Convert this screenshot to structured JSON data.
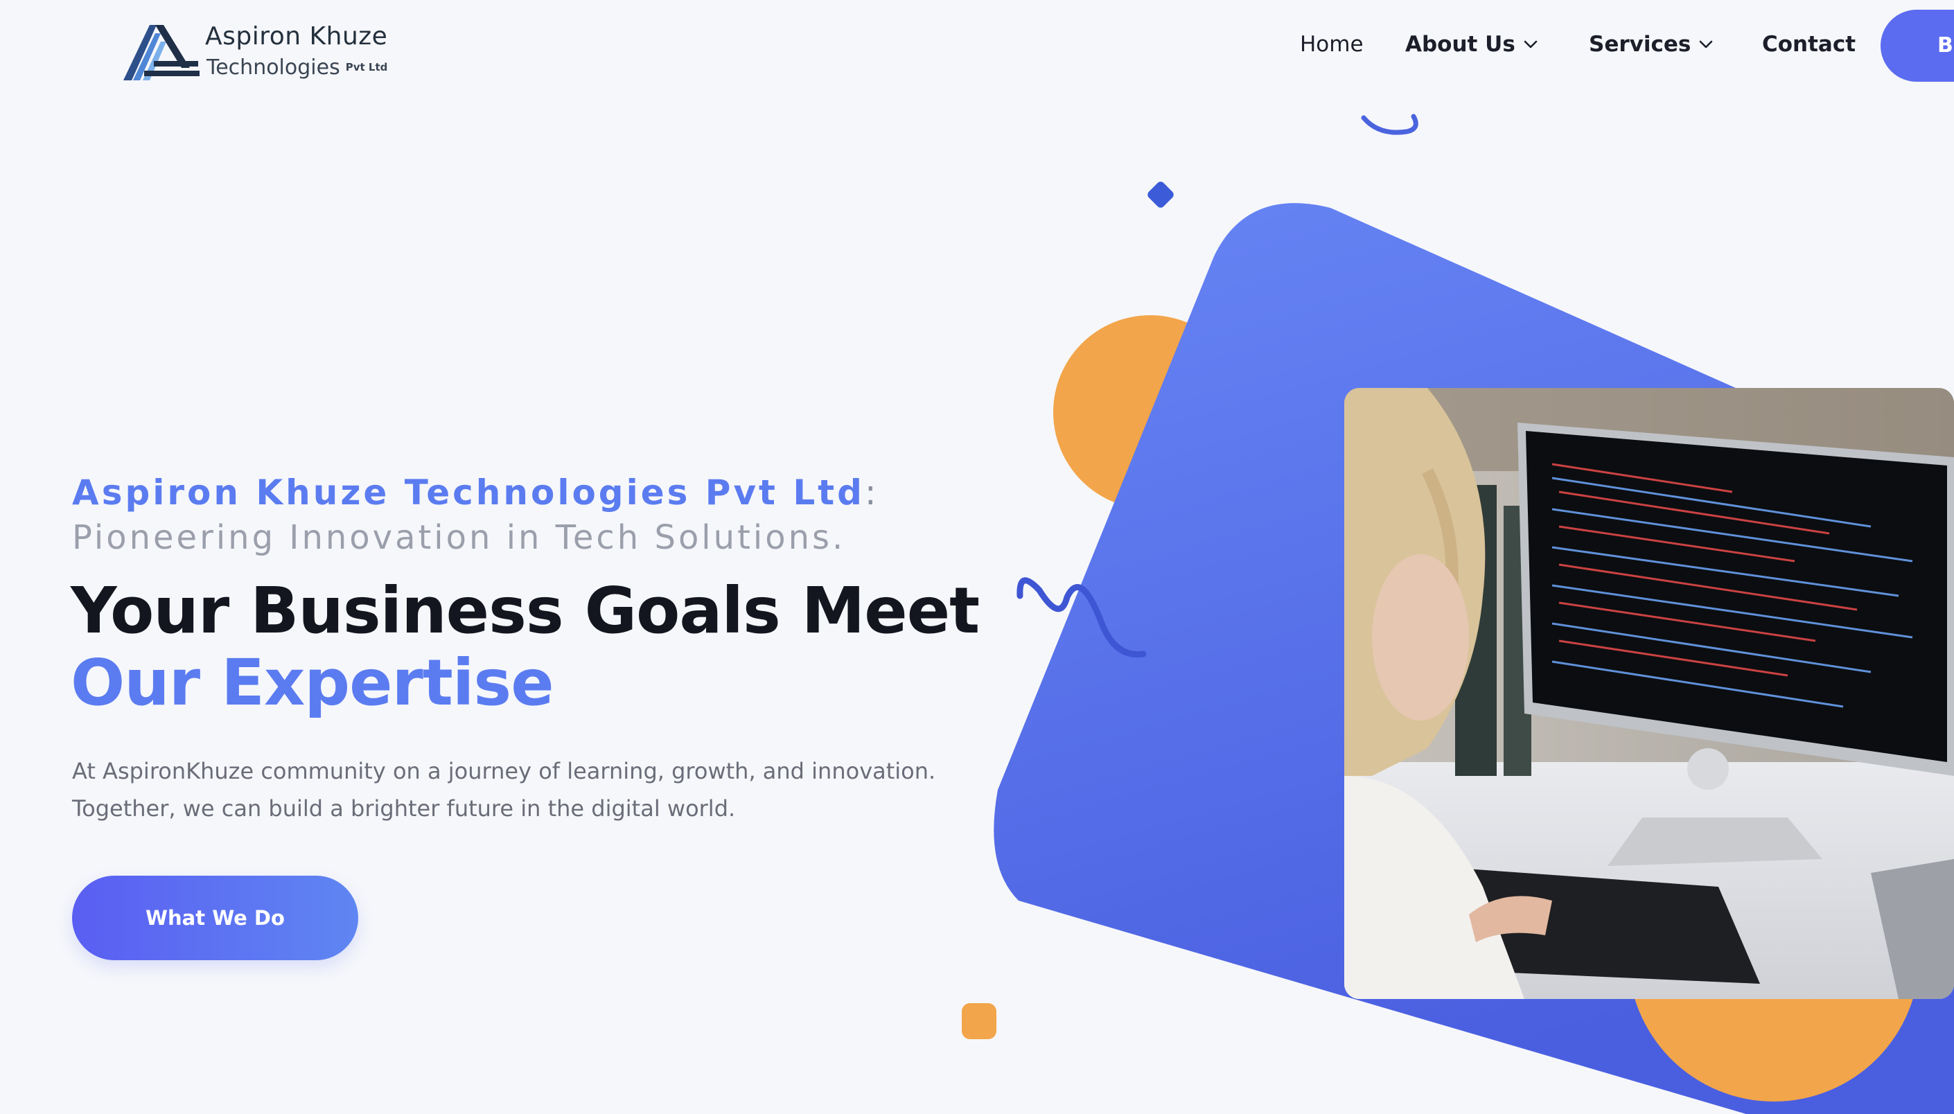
{
  "header": {
    "logo": {
      "title": "Aspiron Khuze",
      "subtitle": "Technologies",
      "suffix": "Pvt Ltd"
    },
    "nav": {
      "home": "Home",
      "about": "About Us",
      "services": "Services",
      "contact": "Contact",
      "cta": "Bo"
    }
  },
  "hero": {
    "company": "Aspiron Khuze Technologies Pvt Ltd",
    "colon": ":",
    "tagline": "Pioneering Innovation in Tech Solutions.",
    "headline_line1": "Your Business Goals Meet",
    "headline_line2": "Our Expertise",
    "description": "At AspironKhuze community on a journey of learning, growth, and innovation. Together, we can build a brighter future in the digital world.",
    "cta_label": "What We Do"
  },
  "colors": {
    "accent": "#5b7cf0",
    "primary_blue": "#5b6cf0",
    "orange": "#f2a54a",
    "background": "#f6f7fb",
    "headline": "#14161f"
  },
  "icons": {
    "chevron": "chevron-down-icon",
    "logo_mark": "logo-mark-icon"
  }
}
